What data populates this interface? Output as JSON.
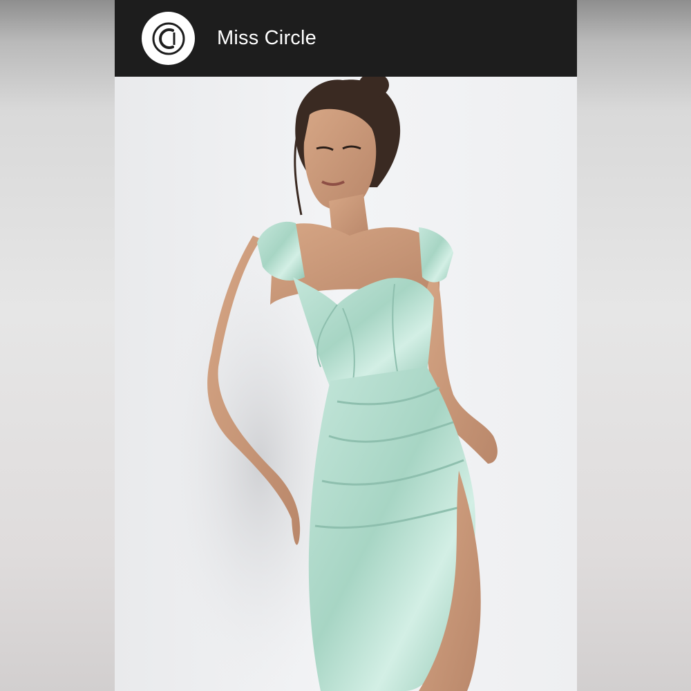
{
  "post": {
    "author": {
      "name": "Miss Circle",
      "avatar_icon": "circle-logo-icon"
    }
  },
  "colors": {
    "header_bg": "#1d1d1d",
    "dress": "#a9d6c6",
    "background": "#f1f2f4"
  }
}
